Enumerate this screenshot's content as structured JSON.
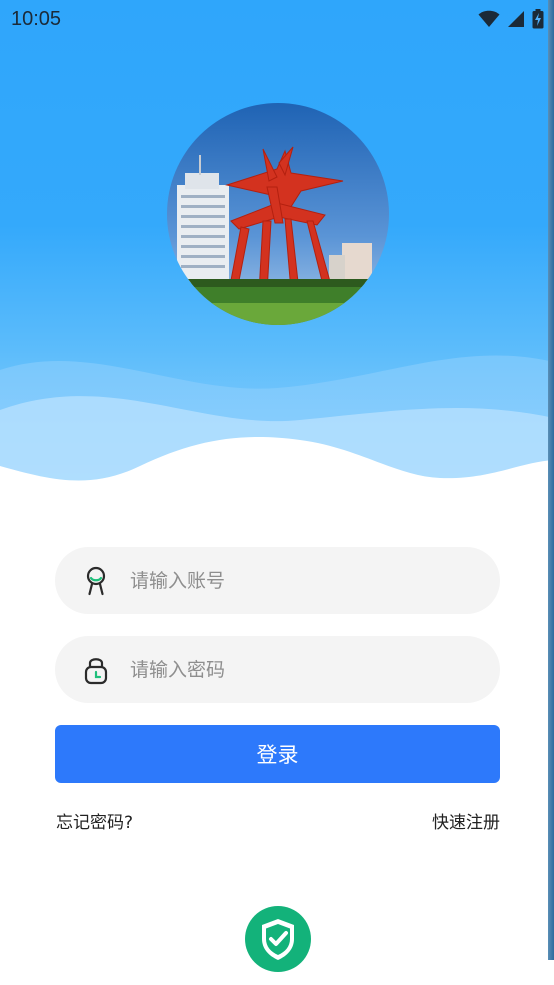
{
  "status_bar": {
    "time": "10:05",
    "icons": [
      "wifi-icon",
      "cell-signal-icon",
      "battery-charging-icon"
    ]
  },
  "header": {
    "avatar": "city-sculpture-photo"
  },
  "form": {
    "account": {
      "placeholder": "请输入账号",
      "value": "",
      "icon": "user-icon"
    },
    "password": {
      "placeholder": "请输入密码",
      "value": "",
      "icon": "lock-icon"
    },
    "login_label": "登录",
    "forgot_label": "忘记密码?",
    "register_label": "快速注册"
  },
  "footer": {
    "badge_icon": "shield-check-icon"
  },
  "colors": {
    "accent": "#2d79fb",
    "sky": "#34a9fb",
    "field_bg": "#f4f4f4",
    "badge": "#13b27a"
  }
}
